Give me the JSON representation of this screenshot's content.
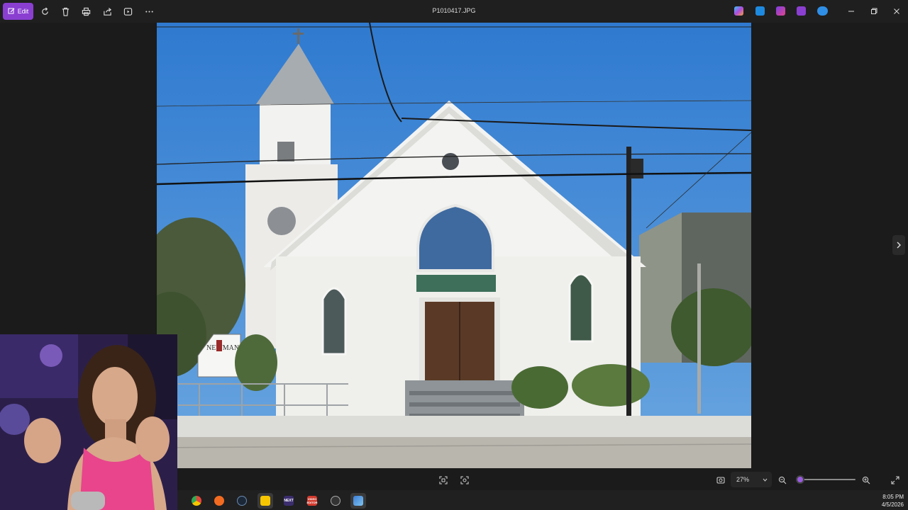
{
  "app": {
    "file_name": "P1010417.JPG",
    "edit_label": "Edit"
  },
  "toolbar": {
    "icons": [
      "rotate-icon",
      "delete-icon",
      "print-icon",
      "share-icon",
      "slideshow-icon",
      "more-icon"
    ]
  },
  "extensions": {
    "icons": [
      "copilot-icon",
      "designer-icon",
      "clipchamp-icon",
      "video-editor-icon",
      "onedrive-icon"
    ]
  },
  "window_controls": [
    "minimize-icon",
    "restore-icon",
    "close-icon"
  ],
  "photo": {
    "sign_text": "NEWMAN"
  },
  "bottom_bar": {
    "zoom_value": "27%",
    "zoom_level": 0.05
  },
  "taskbar": {
    "apps": [
      {
        "name": "chrome",
        "color": "#e8453c"
      },
      {
        "name": "brave",
        "color": "#f36b21"
      },
      {
        "name": "steam",
        "color": "#1b2838"
      },
      {
        "name": "sticky-notes",
        "color": "#f7c600"
      },
      {
        "name": "next",
        "color": "#3b2d6e",
        "label": "NEXT"
      },
      {
        "name": "video-editor",
        "color": "#d23b2e",
        "label": "VIDEO\nEDITOR"
      },
      {
        "name": "speedometer",
        "color": "#333333"
      },
      {
        "name": "photos",
        "color": "#3e7fd6"
      }
    ],
    "time": "8:05 PM",
    "date": "4/5/2026"
  },
  "colors": {
    "accent": "#8a3fd1",
    "sky": "#3f86d4",
    "church": "#f0f0ee"
  }
}
